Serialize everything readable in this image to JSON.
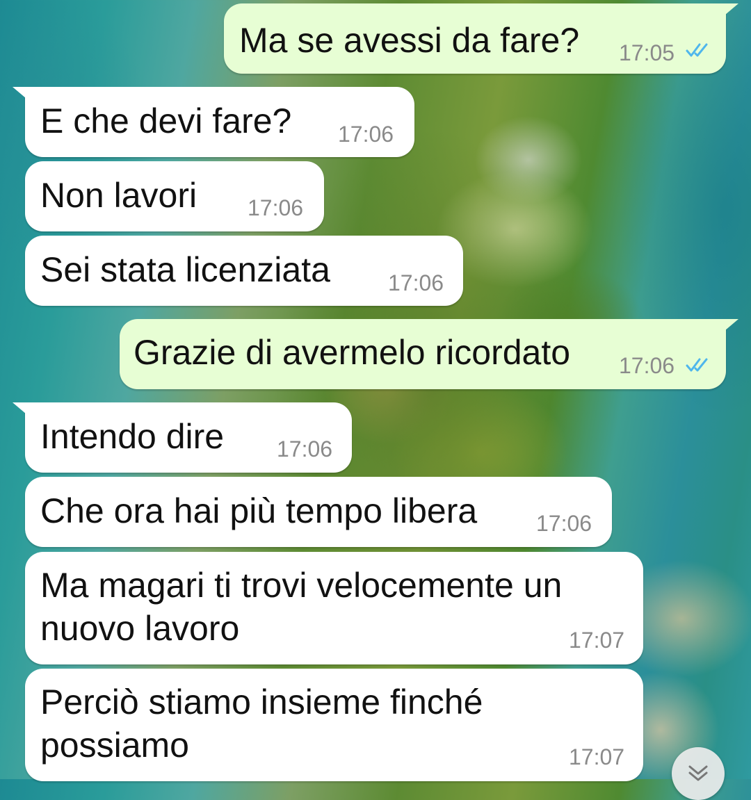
{
  "conversation": {
    "messages": [
      {
        "direction": "out",
        "text": "Ma se avessi da fare?",
        "time": "17:05",
        "status": "read-double-check"
      },
      {
        "direction": "in",
        "text": "E che devi fare?",
        "time": "17:06"
      },
      {
        "direction": "in",
        "text": "Non lavori",
        "time": "17:06"
      },
      {
        "direction": "in",
        "text": "Sei stata licenziata",
        "time": "17:06"
      },
      {
        "direction": "out",
        "text": "Grazie di avermelo ricordato",
        "time": "17:06",
        "status": "read-double-check"
      },
      {
        "direction": "in",
        "text": "Intendo dire",
        "time": "17:06"
      },
      {
        "direction": "in",
        "text": "Che ora hai più tempo libera",
        "time": "17:06"
      },
      {
        "direction": "in",
        "text": "Ma magari ti trovi velocemente un nuovo lavoro",
        "time": "17:07"
      },
      {
        "direction": "in",
        "text": "Perciò stiamo insieme finché possiamo",
        "time": "17:07"
      }
    ]
  },
  "colors": {
    "incoming_bubble": "#ffffff",
    "outgoing_bubble": "#e7fed4",
    "timestamp": "#8a8a8a",
    "read_ticks": "#4fb6ec"
  },
  "icons": {
    "read_receipt": "double-check-icon",
    "scroll_down": "chevron-double-down-icon"
  }
}
